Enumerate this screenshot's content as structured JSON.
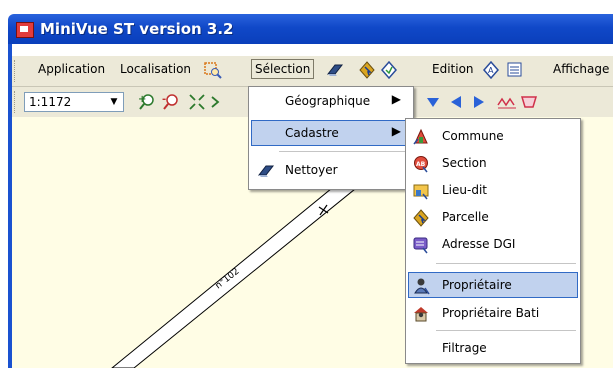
{
  "window": {
    "title": "MiniVue ST version 3.2"
  },
  "menubar": {
    "items": [
      {
        "label": "Application"
      },
      {
        "label": "Localisation"
      },
      {
        "label": "Sélection"
      },
      {
        "label": "Edition"
      },
      {
        "label": "Affichage"
      }
    ]
  },
  "toolbar": {
    "scale": "1:1172",
    "icons": [
      "zoom-in-icon",
      "zoom-out-icon",
      "zoom-extent-icon",
      "arrow-down-icon",
      "arrow-left-icon",
      "arrow-right-icon"
    ]
  },
  "map": {
    "road_label": "n°102"
  },
  "selection_menu": {
    "items": [
      {
        "label": "Géographique",
        "has_submenu": true
      },
      {
        "label": "Cadastre",
        "has_submenu": true,
        "highlighted": true
      },
      {
        "label": "Nettoyer",
        "has_submenu": false
      }
    ]
  },
  "cadastre_menu": {
    "items": [
      {
        "label": "Commune",
        "icon": "commune-icon"
      },
      {
        "label": "Section",
        "icon": "section-icon"
      },
      {
        "label": "Lieu-dit",
        "icon": "lieu-dit-icon"
      },
      {
        "label": "Parcelle",
        "icon": "parcelle-icon"
      },
      {
        "label": "Adresse DGI",
        "icon": "adresse-icon"
      },
      {
        "label": "Propriétaire",
        "icon": "proprietaire-icon",
        "highlighted": true
      },
      {
        "label": "Propriétaire Bati",
        "icon": "proprietaire-bati-icon"
      },
      {
        "label": "Filtrage",
        "icon": ""
      }
    ]
  },
  "colors": {
    "titlebar": "#1048c8",
    "highlight": "#c1d2ee",
    "map_bg": "#fffde5"
  }
}
